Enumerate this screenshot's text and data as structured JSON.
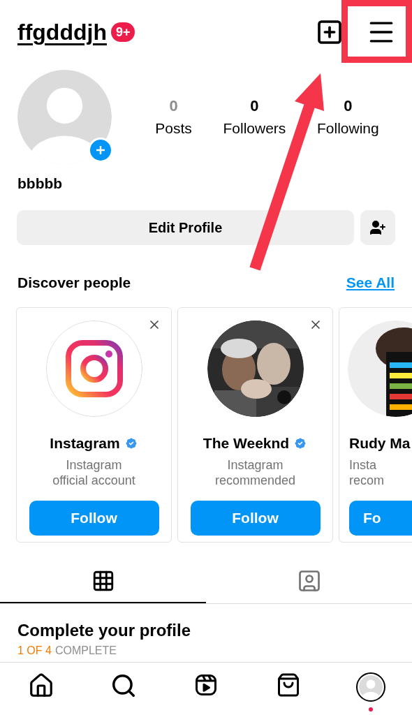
{
  "header": {
    "username": "ffgdddjh",
    "notification_badge": "9+"
  },
  "profile": {
    "name": "bbbbb",
    "stats": [
      {
        "value": "0",
        "label": "Posts",
        "muted": true
      },
      {
        "value": "0",
        "label": "Followers",
        "muted": false
      },
      {
        "value": "0",
        "label": "Following",
        "muted": false
      }
    ],
    "edit_button": "Edit Profile"
  },
  "discover": {
    "title": "Discover people",
    "see_all": "See All",
    "cards": [
      {
        "kind": "logo",
        "name": "Instagram",
        "verified": true,
        "subtitle": [
          "Instagram",
          "official account"
        ],
        "button": "Follow",
        "partial": false
      },
      {
        "kind": "picture",
        "name": "The Weeknd",
        "verified": true,
        "subtitle": [
          "Instagram",
          "recommended"
        ],
        "button": "Follow",
        "partial": false
      },
      {
        "kind": "picture",
        "name": "Rudy Ma",
        "verified": false,
        "subtitle": [
          "Insta",
          "recom"
        ],
        "button": "Fo",
        "partial": true
      }
    ]
  },
  "tabs": [
    {
      "kind": "grid",
      "selected": true
    },
    {
      "kind": "tagged",
      "selected": false
    }
  ],
  "complete": {
    "title": "Complete your profile",
    "progress_count": "1 OF 4",
    "progress_label": "COMPLETE"
  },
  "nav": [
    {
      "kind": "home",
      "selected": false
    },
    {
      "kind": "search",
      "selected": false
    },
    {
      "kind": "reels",
      "selected": false
    },
    {
      "kind": "shop",
      "selected": false
    },
    {
      "kind": "profile",
      "selected": true,
      "dot": true
    }
  ]
}
